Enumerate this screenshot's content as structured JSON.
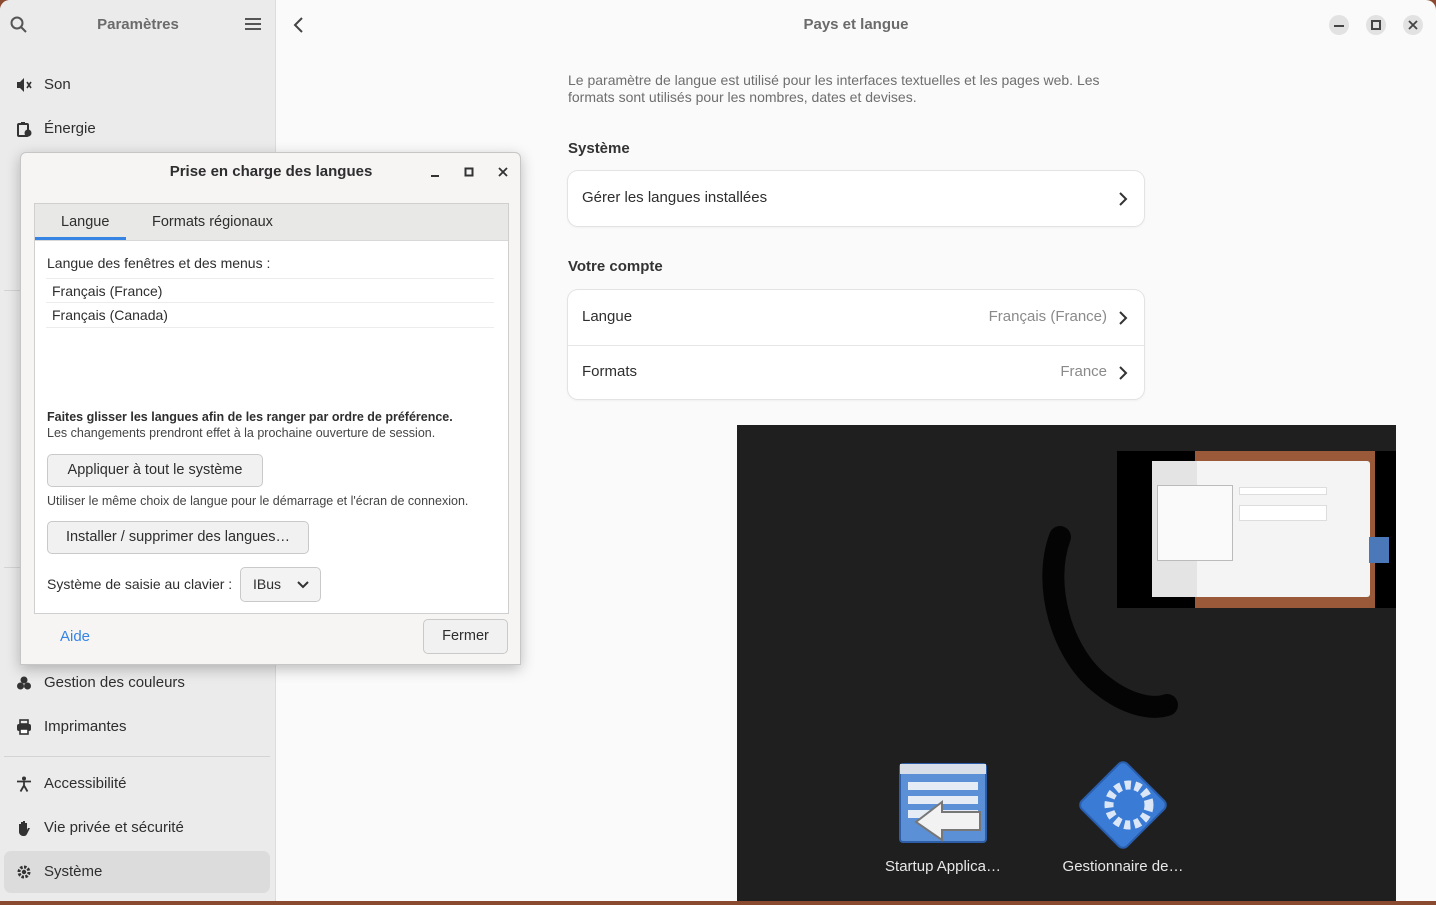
{
  "sidebar": {
    "title": "Paramètres",
    "items": [
      {
        "label": "Son",
        "icon": "speaker-icon"
      },
      {
        "label": "Énergie",
        "icon": "battery-icon"
      },
      {
        "label": "Gestion des couleurs",
        "icon": "color-icon"
      },
      {
        "label": "Imprimantes",
        "icon": "printer-icon"
      },
      {
        "label": "Accessibilité",
        "icon": "accessibility-icon"
      },
      {
        "label": "Vie privée et sécurité",
        "icon": "hand-icon"
      },
      {
        "label": "Système",
        "icon": "gear-icon",
        "active": true
      }
    ]
  },
  "main": {
    "title": "Pays et langue",
    "description": "Le paramètre de langue est utilisé pour les interfaces textuelles et les pages web. Les formats sont utilisés pour les nombres, dates et devises.",
    "system_section": "Système",
    "manage_languages": "Gérer les langues installées",
    "account_section": "Votre compte",
    "language_label": "Langue",
    "language_value": "Français (France)",
    "formats_label": "Formats",
    "formats_value": "France"
  },
  "dialog": {
    "title": "Prise en charge des langues",
    "tabs": [
      "Langue",
      "Formats régionaux"
    ],
    "menu_language_label": "Langue des fenêtres et des menus :",
    "languages": [
      "Français (France)",
      "Français (Canada)"
    ],
    "drag_hint": "Faites glisser les langues afin de les ranger par ordre de préférence.",
    "session_hint": "Les changements prendront effet à la prochaine ouverture de session.",
    "apply_button": "Appliquer à tout le système",
    "apply_hint": "Utiliser le même choix de langue pour le démarrage et l'écran de connexion.",
    "install_button": "Installer / supprimer des langues…",
    "input_label": "Système de saisie au clavier :",
    "input_value": "IBus",
    "help": "Aide",
    "close": "Fermer"
  },
  "overlay": {
    "apps": [
      "Startup Applica…",
      "Gestionnaire de…"
    ]
  }
}
